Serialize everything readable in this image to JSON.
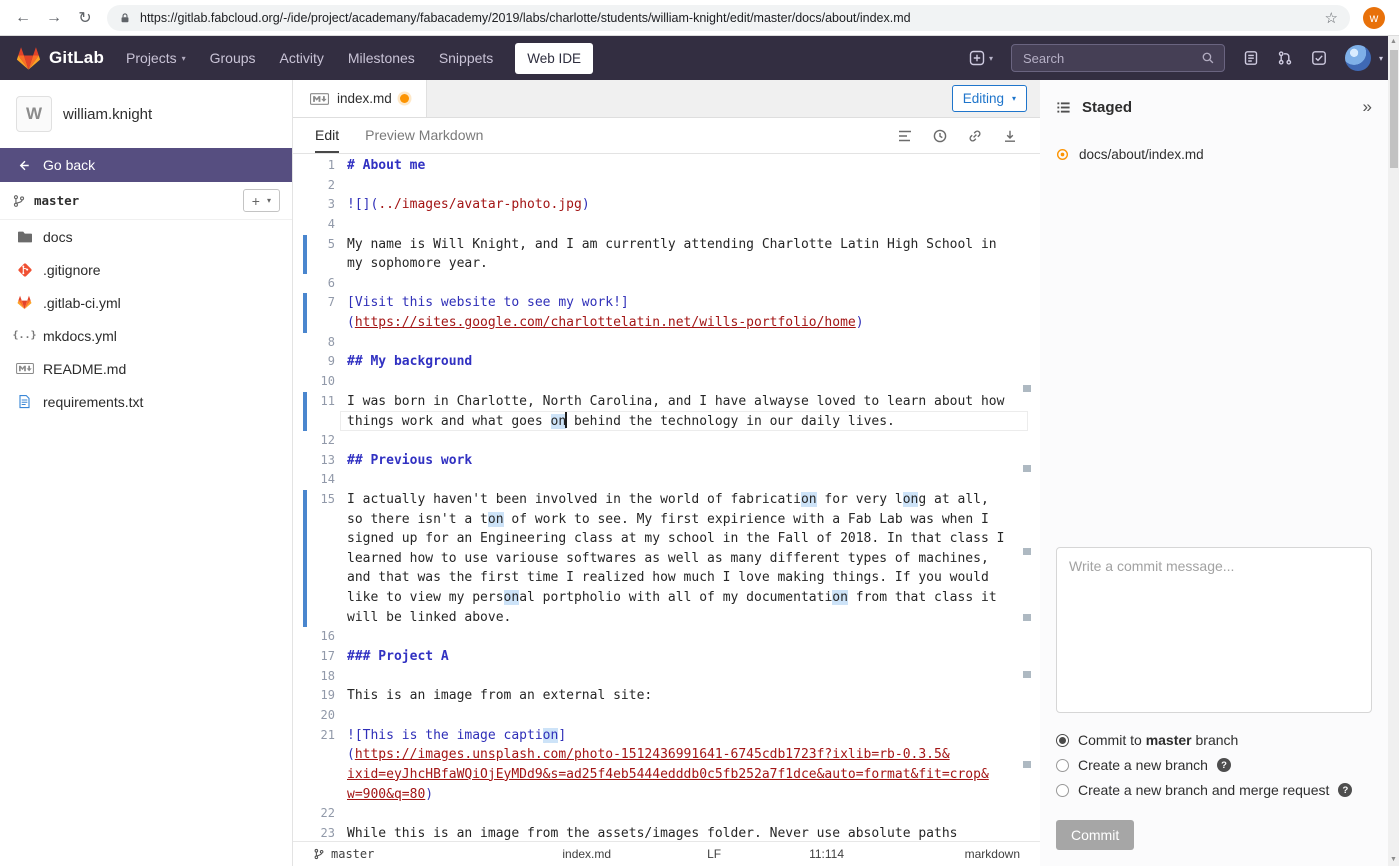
{
  "colors": {
    "accent_blue": "#1f75cb",
    "brand_orange": "#fc6d26",
    "modified_orange": "#fc9403",
    "link_red": "#a31515"
  },
  "browser": {
    "url": "https://gitlab.fabcloud.org/-/ide/project/academany/fabacademy/2019/labs/charlotte/students/william-knight/edit/master/docs/about/index.md",
    "avatar_letter": "w"
  },
  "navbar": {
    "brand": "GitLab",
    "links": [
      {
        "label": "Projects",
        "caret": true
      },
      {
        "label": "Groups"
      },
      {
        "label": "Activity"
      },
      {
        "label": "Milestones"
      },
      {
        "label": "Snippets"
      }
    ],
    "active_item": "Web IDE",
    "search_placeholder": "Search"
  },
  "sidebar": {
    "user_initial": "W",
    "user": "william.knight",
    "back_label": "Go back",
    "branch": "master",
    "files": [
      {
        "name": "docs",
        "icon": "folder-icon"
      },
      {
        "name": ".gitignore",
        "icon": "git-icon"
      },
      {
        "name": ".gitlab-ci.yml",
        "icon": "gitlab-icon"
      },
      {
        "name": "mkdocs.yml",
        "icon": "braces-icon"
      },
      {
        "name": "README.md",
        "icon": "markdown-icon"
      },
      {
        "name": "requirements.txt",
        "icon": "text-file-icon"
      }
    ]
  },
  "editor_header": {
    "tab": "index.md",
    "mode_button": "Editing",
    "tabs": [
      "Edit",
      "Preview Markdown"
    ],
    "active_tab": "Edit"
  },
  "editor": {
    "rows": [
      {
        "n": "1",
        "s": [
          [
            "h",
            "# About me"
          ]
        ]
      },
      {
        "n": "2",
        "s": []
      },
      {
        "n": "3",
        "s": [
          [
            "l",
            "![]("
          ],
          [
            "s",
            "../images/avatar-photo.jpg"
          ],
          [
            "l",
            ")"
          ]
        ]
      },
      {
        "n": "4",
        "s": []
      },
      {
        "n": "5",
        "b": true,
        "s": [
          [
            "p",
            "My name is Will Knight, and I am currently attending Charlotte Latin High School in"
          ]
        ]
      },
      {
        "n": "",
        "b": true,
        "s": [
          [
            "p",
            "my sophomore year."
          ]
        ]
      },
      {
        "n": "6",
        "s": []
      },
      {
        "n": "7",
        "b": true,
        "s": [
          [
            "l",
            "[Visit this website to see my work!]"
          ]
        ]
      },
      {
        "n": "",
        "b": true,
        "s": [
          [
            "l",
            "("
          ],
          [
            "u",
            "https://sites.google.com/charlottelatin.net/wills-portfolio/home"
          ],
          [
            "l",
            ")"
          ]
        ]
      },
      {
        "n": "8",
        "s": []
      },
      {
        "n": "9",
        "s": [
          [
            "h",
            "## My background"
          ]
        ]
      },
      {
        "n": "10",
        "s": []
      },
      {
        "n": "11",
        "b": true,
        "s": [
          [
            "p",
            "I was born in Charlotte, North Carolina, and I have alwayse loved to learn about how"
          ]
        ]
      },
      {
        "n": "",
        "b": true,
        "cl": true,
        "s": [
          [
            "p",
            "things work and what goes "
          ],
          [
            "hl",
            "on"
          ],
          [
            "cur",
            ""
          ],
          [
            "p",
            " behind the technology in our daily lives."
          ]
        ]
      },
      {
        "n": "12",
        "s": []
      },
      {
        "n": "13",
        "s": [
          [
            "h",
            "## Previous work"
          ]
        ]
      },
      {
        "n": "14",
        "s": []
      },
      {
        "n": "15",
        "b": true,
        "s": [
          [
            "p",
            "I actually haven't been involved in the world of fabricati"
          ],
          [
            "hl",
            "on"
          ],
          [
            "p",
            " for very l"
          ],
          [
            "hl",
            "on"
          ],
          [
            "p",
            "g at all,"
          ]
        ]
      },
      {
        "n": "",
        "b": true,
        "s": [
          [
            "p",
            "so there isn't a t"
          ],
          [
            "hl",
            "on"
          ],
          [
            "p",
            " of work to see. My first expirience with a Fab Lab was when I"
          ]
        ]
      },
      {
        "n": "",
        "b": true,
        "s": [
          [
            "p",
            "signed up for an Engineering class at my school in the Fall of 2018. In that class I"
          ]
        ]
      },
      {
        "n": "",
        "b": true,
        "s": [
          [
            "p",
            "learned how to use variouse softwares as well as many different types of machines,"
          ]
        ]
      },
      {
        "n": "",
        "b": true,
        "s": [
          [
            "p",
            "and that was the first time I realized how much I love making things. If you would"
          ]
        ]
      },
      {
        "n": "",
        "b": true,
        "s": [
          [
            "p",
            "like to view my pers"
          ],
          [
            "hl",
            "on"
          ],
          [
            "p",
            "al portpholio with all of my documentati"
          ],
          [
            "hl",
            "on"
          ],
          [
            "p",
            " from that class it"
          ]
        ]
      },
      {
        "n": "",
        "b": true,
        "s": [
          [
            "p",
            "will be linked above."
          ]
        ]
      },
      {
        "n": "16",
        "s": []
      },
      {
        "n": "17",
        "s": [
          [
            "h",
            "### Project A"
          ]
        ]
      },
      {
        "n": "18",
        "s": []
      },
      {
        "n": "19",
        "s": [
          [
            "p",
            "This is an image from an external site:"
          ]
        ]
      },
      {
        "n": "20",
        "s": []
      },
      {
        "n": "21",
        "s": [
          [
            "l",
            "![This is the image capti"
          ],
          [
            "hl2",
            "on"
          ],
          [
            "l",
            "]"
          ]
        ]
      },
      {
        "n": "",
        "s": [
          [
            "l",
            "("
          ],
          [
            "u",
            "https://images.unsplash.com/photo-1512436991641-6745cdb1723f?ixlib=rb-0.3.5&"
          ]
        ]
      },
      {
        "n": "",
        "s": [
          [
            "u",
            "ixid=eyJhcHBfaWQiOjEyMDd9&s=ad25f4eb5444edddb0c5fb252a7f1dce&auto=format&fit=crop&"
          ]
        ]
      },
      {
        "n": "",
        "s": [
          [
            "u",
            "w=900&q=80"
          ],
          [
            "l",
            ")"
          ]
        ]
      },
      {
        "n": "22",
        "s": []
      },
      {
        "n": "23",
        "s": [
          [
            "p",
            "While this is an image from the assets/images folder. Never use absolute paths"
          ]
        ]
      }
    ]
  },
  "commit_panel": {
    "title": "Staged",
    "staged_file": "docs/about/index.md",
    "message_placeholder": "Write a commit message...",
    "options": [
      {
        "pre": "Commit to ",
        "bold": "master",
        "post": " branch",
        "selected": true
      },
      {
        "label": "Create a new branch",
        "help": true
      },
      {
        "label": "Create a new branch and merge request",
        "help": true
      }
    ],
    "commit_button": "Commit"
  },
  "status_bar": {
    "branch": "master",
    "file": "index.md",
    "eol": "LF",
    "position": "11:114",
    "language": "markdown"
  }
}
